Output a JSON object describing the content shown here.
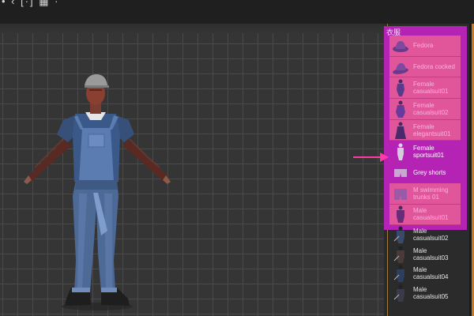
{
  "topbar": {
    "glyphs": "• ‹ [·] ▦ ·"
  },
  "panel": {
    "title": "衣服",
    "items": [
      {
        "label": "Fedora",
        "state": "selected"
      },
      {
        "label": "Fedora cocked",
        "state": "selected"
      },
      {
        "label": "Female casualsuit01",
        "state": "selected"
      },
      {
        "label": "Female casualsuit02",
        "state": "selected"
      },
      {
        "label": "Female elegantsuit01",
        "state": "selected"
      },
      {
        "label": "Female sportsuit01",
        "state": "plain"
      },
      {
        "label": "Grey shorts",
        "state": "plain"
      },
      {
        "label": "M swimming trunks 01",
        "state": "selected"
      },
      {
        "label": "Male casualsuit01",
        "state": "selected"
      }
    ],
    "more_items": [
      {
        "label": "Male casualsuit02"
      },
      {
        "label": "Male casualsuit03"
      },
      {
        "label": "Male casualsuit04"
      },
      {
        "label": "Male casualsuit05"
      }
    ]
  },
  "colors": {
    "highlight": "#b523b5",
    "selected_row": "#e1569a",
    "arrow": "#ff3aa6",
    "grid": "#4a4a4a"
  }
}
